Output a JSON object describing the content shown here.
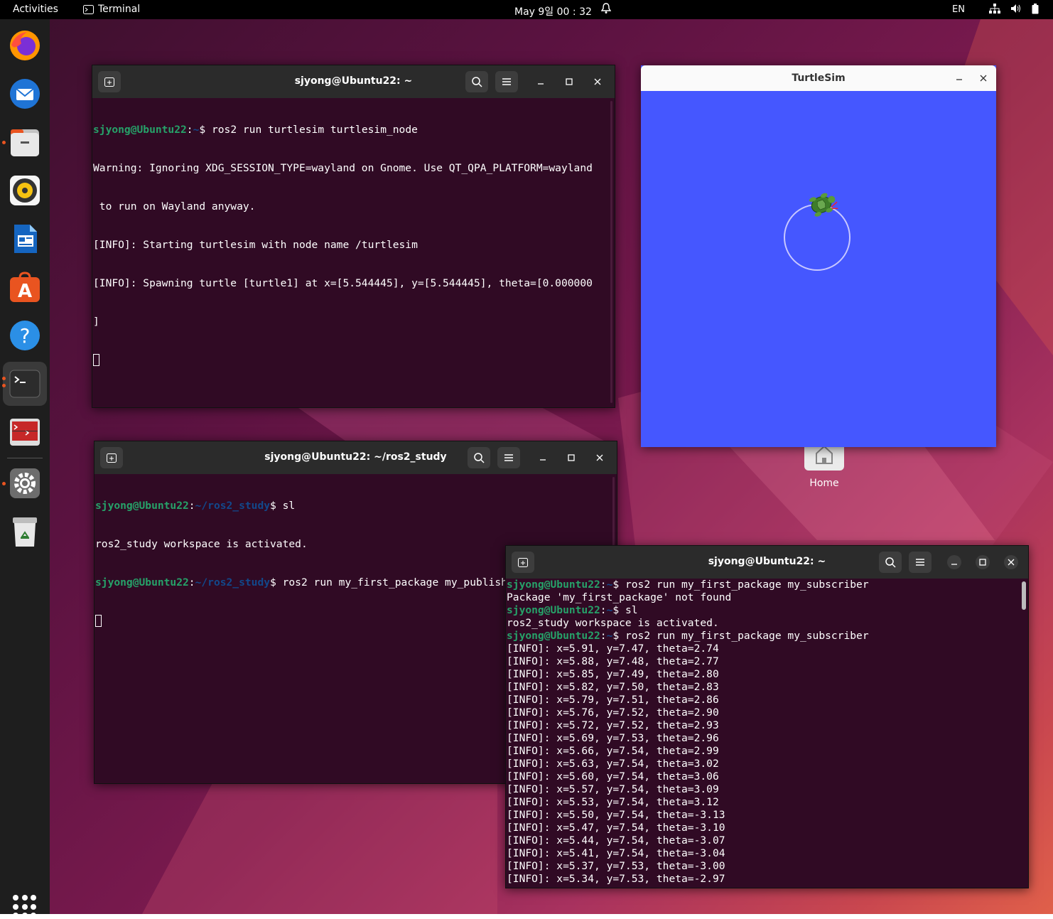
{
  "topbar": {
    "activities": "Activities",
    "app_name": "Terminal",
    "clock": "May 9일  00 : 32",
    "lang": "EN"
  },
  "dock": {
    "items": [
      "firefox",
      "thunderbird",
      "files",
      "rhythmbox",
      "libreoffice-writer",
      "app-center",
      "help",
      "terminal",
      "system-monitor",
      "settings",
      "trash"
    ]
  },
  "desktop": {
    "home_label": "Home"
  },
  "term1": {
    "title": "sjyong@Ubuntu22: ~",
    "lines": [
      {
        "user": "sjyong@Ubuntu22",
        "path": "~",
        "cmd": "$ ros2 run turtlesim turtlesim_node"
      },
      {
        "text": "Warning: Ignoring XDG_SESSION_TYPE=wayland on Gnome. Use QT_QPA_PLATFORM=wayland"
      },
      {
        "text": " to run on Wayland anyway."
      },
      {
        "text": "[INFO]: Starting turtlesim with node name /turtlesim"
      },
      {
        "text": "[INFO]: Spawning turtle [turtle1] at x=[5.544445], y=[5.544445], theta=[0.000000"
      },
      {
        "text": "]"
      }
    ]
  },
  "term2": {
    "title": "sjyong@Ubuntu22: ~/ros2_study",
    "lines": [
      {
        "user": "sjyong@Ubuntu22",
        "path": "~/ros2_study",
        "cmd": "$ sl"
      },
      {
        "text": "ros2_study workspace is activated."
      },
      {
        "user": "sjyong@Ubuntu22",
        "path": "~/ros2_study",
        "cmd": "$ ros2 run my_first_package my_publisher"
      }
    ]
  },
  "term3": {
    "title": "sjyong@Ubuntu22: ~",
    "lines": [
      {
        "user": "sjyong@Ubuntu22",
        "path": "~",
        "cmd": "$ ros2 run my_first_package my_subscriber"
      },
      {
        "text": "Package 'my_first_package' not found"
      },
      {
        "user": "sjyong@Ubuntu22",
        "path": "~",
        "cmd": "$ sl"
      },
      {
        "text": "ros2_study workspace is activated."
      },
      {
        "user": "sjyong@Ubuntu22",
        "path": "~",
        "cmd": "$ ros2 run my_first_package my_subscriber"
      },
      {
        "text": "[INFO]: x=5.91, y=7.47, theta=2.74"
      },
      {
        "text": "[INFO]: x=5.88, y=7.48, theta=2.77"
      },
      {
        "text": "[INFO]: x=5.85, y=7.49, theta=2.80"
      },
      {
        "text": "[INFO]: x=5.82, y=7.50, theta=2.83"
      },
      {
        "text": "[INFO]: x=5.79, y=7.51, theta=2.86"
      },
      {
        "text": "[INFO]: x=5.76, y=7.52, theta=2.90"
      },
      {
        "text": "[INFO]: x=5.72, y=7.52, theta=2.93"
      },
      {
        "text": "[INFO]: x=5.69, y=7.53, theta=2.96"
      },
      {
        "text": "[INFO]: x=5.66, y=7.54, theta=2.99"
      },
      {
        "text": "[INFO]: x=5.63, y=7.54, theta=3.02"
      },
      {
        "text": "[INFO]: x=5.60, y=7.54, theta=3.06"
      },
      {
        "text": "[INFO]: x=5.57, y=7.54, theta=3.09"
      },
      {
        "text": "[INFO]: x=5.53, y=7.54, theta=3.12"
      },
      {
        "text": "[INFO]: x=5.50, y=7.54, theta=-3.13"
      },
      {
        "text": "[INFO]: x=5.47, y=7.54, theta=-3.10"
      },
      {
        "text": "[INFO]: x=5.44, y=7.54, theta=-3.07"
      },
      {
        "text": "[INFO]: x=5.41, y=7.54, theta=-3.04"
      },
      {
        "text": "[INFO]: x=5.37, y=7.53, theta=-3.00"
      },
      {
        "text": "[INFO]: x=5.34, y=7.53, theta=-2.97"
      }
    ]
  },
  "turtlesim": {
    "title": "TurtleSim",
    "bg_color": "#4557ff"
  },
  "colors": {
    "terminal_bg": "#300a24",
    "prompt_user": "#26a269",
    "prompt_path": "#12488b",
    "accent": "#e95420"
  }
}
